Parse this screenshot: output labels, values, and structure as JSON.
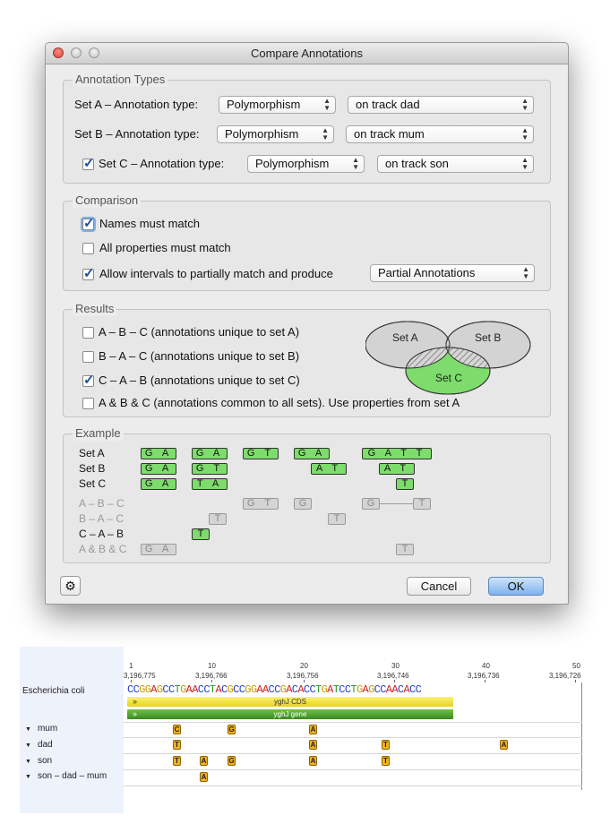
{
  "dialog": {
    "title": "Compare Annotations",
    "annotation_types": {
      "legend": "Annotation Types",
      "set_a_label": "Set A – Annotation type:",
      "set_a_type": "Polymorphism",
      "set_a_track": "on track dad",
      "set_b_label": "Set B – Annotation type:",
      "set_b_type": "Polymorphism",
      "set_b_track": "on track mum",
      "set_c_label": "Set C – Annotation type:",
      "set_c_type": "Polymorphism",
      "set_c_track": "on track son",
      "set_c_enabled": true
    },
    "comparison": {
      "legend": "Comparison",
      "names_must_match": "Names must match",
      "names_checked": true,
      "all_properties": "All properties must match",
      "all_properties_checked": false,
      "allow_intervals": "Allow intervals to partially match and produce",
      "allow_intervals_checked": true,
      "produce_option": "Partial Annotations"
    },
    "results": {
      "legend": "Results",
      "opt1": "A – B – C (annotations unique to set A)",
      "opt1_checked": false,
      "opt2": "B – A – C (annotations unique to set B)",
      "opt2_checked": false,
      "opt3": "C – A – B (annotations unique to set C)",
      "opt3_checked": true,
      "opt4": "A & B & C (annotations common to all sets). Use properties from set A",
      "opt4_checked": false,
      "venn": {
        "a": "Set A",
        "b": "Set B",
        "c": "Set C",
        "highlight_color": "#7ddc6c"
      }
    },
    "example": {
      "legend": "Example",
      "rows": [
        {
          "label": "Set A",
          "dim": false,
          "chips": [
            "G A",
            "G A",
            "G T",
            "G A",
            "G A T T"
          ]
        },
        {
          "label": "Set B",
          "dim": false,
          "chips": [
            "G A",
            "G T",
            "A T",
            "A T"
          ]
        },
        {
          "label": "Set C",
          "dim": false,
          "chips": [
            "G A",
            "T A",
            "T"
          ]
        },
        {
          "label": "A – B – C",
          "dim": true,
          "chips": [
            "G T",
            "G",
            "G",
            "T"
          ]
        },
        {
          "label": "B – A – C",
          "dim": true,
          "chips": [
            "T",
            "T"
          ]
        },
        {
          "label": "C – A – B",
          "dim": false,
          "chips": [
            "T"
          ]
        },
        {
          "label": "A & B & C",
          "dim": true,
          "chips": [
            "G A",
            "T"
          ]
        }
      ]
    },
    "buttons": {
      "cancel": "Cancel",
      "ok": "OK",
      "gear_icon": "gear-icon"
    }
  },
  "sequence_view": {
    "ruler": {
      "numbers": [
        "1",
        "10",
        "20",
        "30",
        "40",
        "50"
      ],
      "coords": [
        "3,196,775",
        "3,196,766",
        "3,196,756",
        "3,196,746",
        "3,196,736",
        "3,196,726"
      ]
    },
    "organism": "Escherichia coli",
    "sequence": "CCGGAGCCTGAACCTACGCCGGAACCGACACCTGATCCTGAGCCAACACC",
    "base_colors": {
      "A": "#d31f1f",
      "C": "#1f3fc8",
      "G": "#c99a00",
      "T": "#2a9a2a"
    },
    "annotations": [
      {
        "label": "yghJ CDS",
        "color": "#f4e23a"
      },
      {
        "label": "yghJ gene",
        "color": "#4fa52c"
      }
    ],
    "tracks": [
      {
        "label": "mum",
        "snps": [
          "C",
          "G",
          "A"
        ]
      },
      {
        "label": "dad",
        "snps": [
          "T",
          "A",
          "T",
          "A"
        ]
      },
      {
        "label": "son",
        "snps": [
          "T",
          "A",
          "G",
          "A",
          "T"
        ]
      },
      {
        "label": "son – dad – mum",
        "snps": [
          "A"
        ]
      }
    ]
  }
}
